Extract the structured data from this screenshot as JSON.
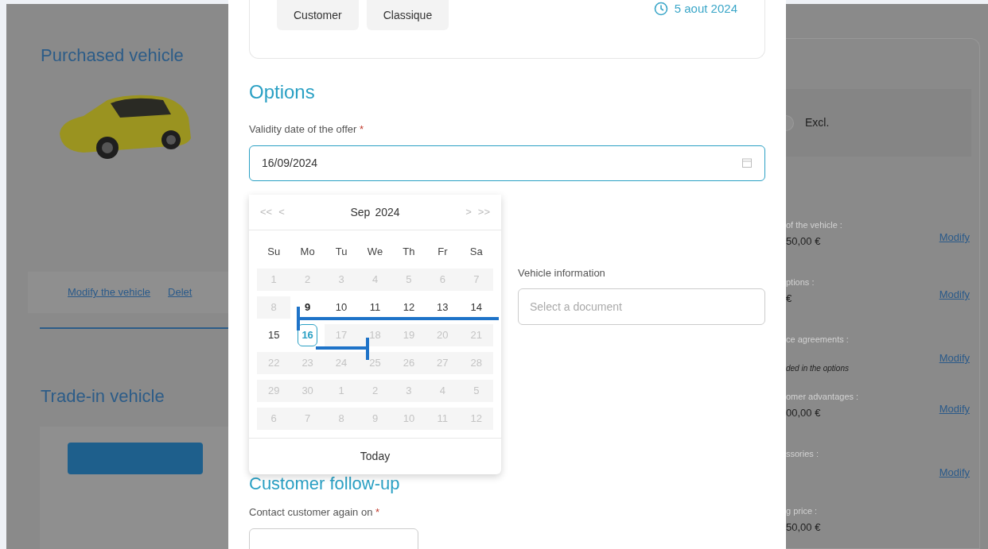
{
  "background": {
    "left": {
      "title": "Purchased vehicle",
      "links": [
        "Modify the vehicle",
        "Delet"
      ],
      "trade_in_title": "Trade-in vehicle"
    },
    "right": {
      "tax_option": "Excl.",
      "tax_selected": false,
      "rows": [
        {
          "label": "of the vehicle :",
          "value": "50,00 €",
          "note": "",
          "link": "Modify"
        },
        {
          "label": "ptions :",
          "value": "€",
          "note": "",
          "link": "Modify"
        },
        {
          "label": "ce agreements :",
          "value": "",
          "note": "ded in the options",
          "link": "Modify"
        },
        {
          "label": "omer advantages :",
          "value": "00,00 €",
          "note": "",
          "link": "Modify"
        },
        {
          "label": "ssories :",
          "value": "",
          "note": "",
          "link": "Modify"
        },
        {
          "label": "g price :",
          "value": "50,00 €",
          "note": "",
          "link": ""
        }
      ]
    }
  },
  "modal": {
    "tags": [
      "Customer",
      "Classique"
    ],
    "date": "5 aout 2024",
    "options_title": "Options",
    "validity_label": "Validity date of the offer",
    "required_mark": "*",
    "validity_value": "16/09/2024",
    "vehicle_info_label": "Vehicle information",
    "vehicle_info_placeholder": "Select a document",
    "followup_title": "Customer follow-up",
    "contact_label": "Contact customer again on",
    "contact_required_mark": "*"
  },
  "calendar": {
    "prev_year": "<<",
    "prev_month": "<",
    "month": "Sep",
    "year": "2024",
    "next_month": ">",
    "next_year": ">>",
    "weekdays": [
      "Su",
      "Mo",
      "Tu",
      "We",
      "Th",
      "Fr",
      "Sa"
    ],
    "days": [
      {
        "label": "1",
        "disabled": true,
        "selected": false,
        "today": false
      },
      {
        "label": "2",
        "disabled": true,
        "selected": false,
        "today": false
      },
      {
        "label": "3",
        "disabled": true,
        "selected": false,
        "today": false
      },
      {
        "label": "4",
        "disabled": true,
        "selected": false,
        "today": false
      },
      {
        "label": "5",
        "disabled": true,
        "selected": false,
        "today": false
      },
      {
        "label": "6",
        "disabled": true,
        "selected": false,
        "today": false
      },
      {
        "label": "7",
        "disabled": true,
        "selected": false,
        "today": false
      },
      {
        "label": "8",
        "disabled": true,
        "selected": false,
        "today": false
      },
      {
        "label": "9",
        "disabled": false,
        "selected": false,
        "today": true
      },
      {
        "label": "10",
        "disabled": false,
        "selected": false,
        "today": false
      },
      {
        "label": "11",
        "disabled": false,
        "selected": false,
        "today": false
      },
      {
        "label": "12",
        "disabled": false,
        "selected": false,
        "today": false
      },
      {
        "label": "13",
        "disabled": false,
        "selected": false,
        "today": false
      },
      {
        "label": "14",
        "disabled": false,
        "selected": false,
        "today": false
      },
      {
        "label": "15",
        "disabled": false,
        "selected": false,
        "today": false
      },
      {
        "label": "16",
        "disabled": false,
        "selected": true,
        "today": false
      },
      {
        "label": "17",
        "disabled": true,
        "selected": false,
        "today": false
      },
      {
        "label": "18",
        "disabled": true,
        "selected": false,
        "today": false
      },
      {
        "label": "19",
        "disabled": true,
        "selected": false,
        "today": false
      },
      {
        "label": "20",
        "disabled": true,
        "selected": false,
        "today": false
      },
      {
        "label": "21",
        "disabled": true,
        "selected": false,
        "today": false
      },
      {
        "label": "22",
        "disabled": true,
        "selected": false,
        "today": false
      },
      {
        "label": "23",
        "disabled": true,
        "selected": false,
        "today": false
      },
      {
        "label": "24",
        "disabled": true,
        "selected": false,
        "today": false
      },
      {
        "label": "25",
        "disabled": true,
        "selected": false,
        "today": false
      },
      {
        "label": "26",
        "disabled": true,
        "selected": false,
        "today": false
      },
      {
        "label": "27",
        "disabled": true,
        "selected": false,
        "today": false
      },
      {
        "label": "28",
        "disabled": true,
        "selected": false,
        "today": false
      },
      {
        "label": "29",
        "disabled": true,
        "selected": false,
        "today": false
      },
      {
        "label": "30",
        "disabled": true,
        "selected": false,
        "today": false
      },
      {
        "label": "1",
        "disabled": true,
        "selected": false,
        "today": false
      },
      {
        "label": "2",
        "disabled": true,
        "selected": false,
        "today": false
      },
      {
        "label": "3",
        "disabled": true,
        "selected": false,
        "today": false
      },
      {
        "label": "4",
        "disabled": true,
        "selected": false,
        "today": false
      },
      {
        "label": "5",
        "disabled": true,
        "selected": false,
        "today": false
      },
      {
        "label": "6",
        "disabled": true,
        "selected": false,
        "today": false
      },
      {
        "label": "7",
        "disabled": true,
        "selected": false,
        "today": false
      },
      {
        "label": "8",
        "disabled": true,
        "selected": false,
        "today": false
      },
      {
        "label": "9",
        "disabled": true,
        "selected": false,
        "today": false
      },
      {
        "label": "10",
        "disabled": true,
        "selected": false,
        "today": false
      },
      {
        "label": "11",
        "disabled": true,
        "selected": false,
        "today": false
      },
      {
        "label": "12",
        "disabled": true,
        "selected": false,
        "today": false
      }
    ],
    "today_button": "Today"
  }
}
